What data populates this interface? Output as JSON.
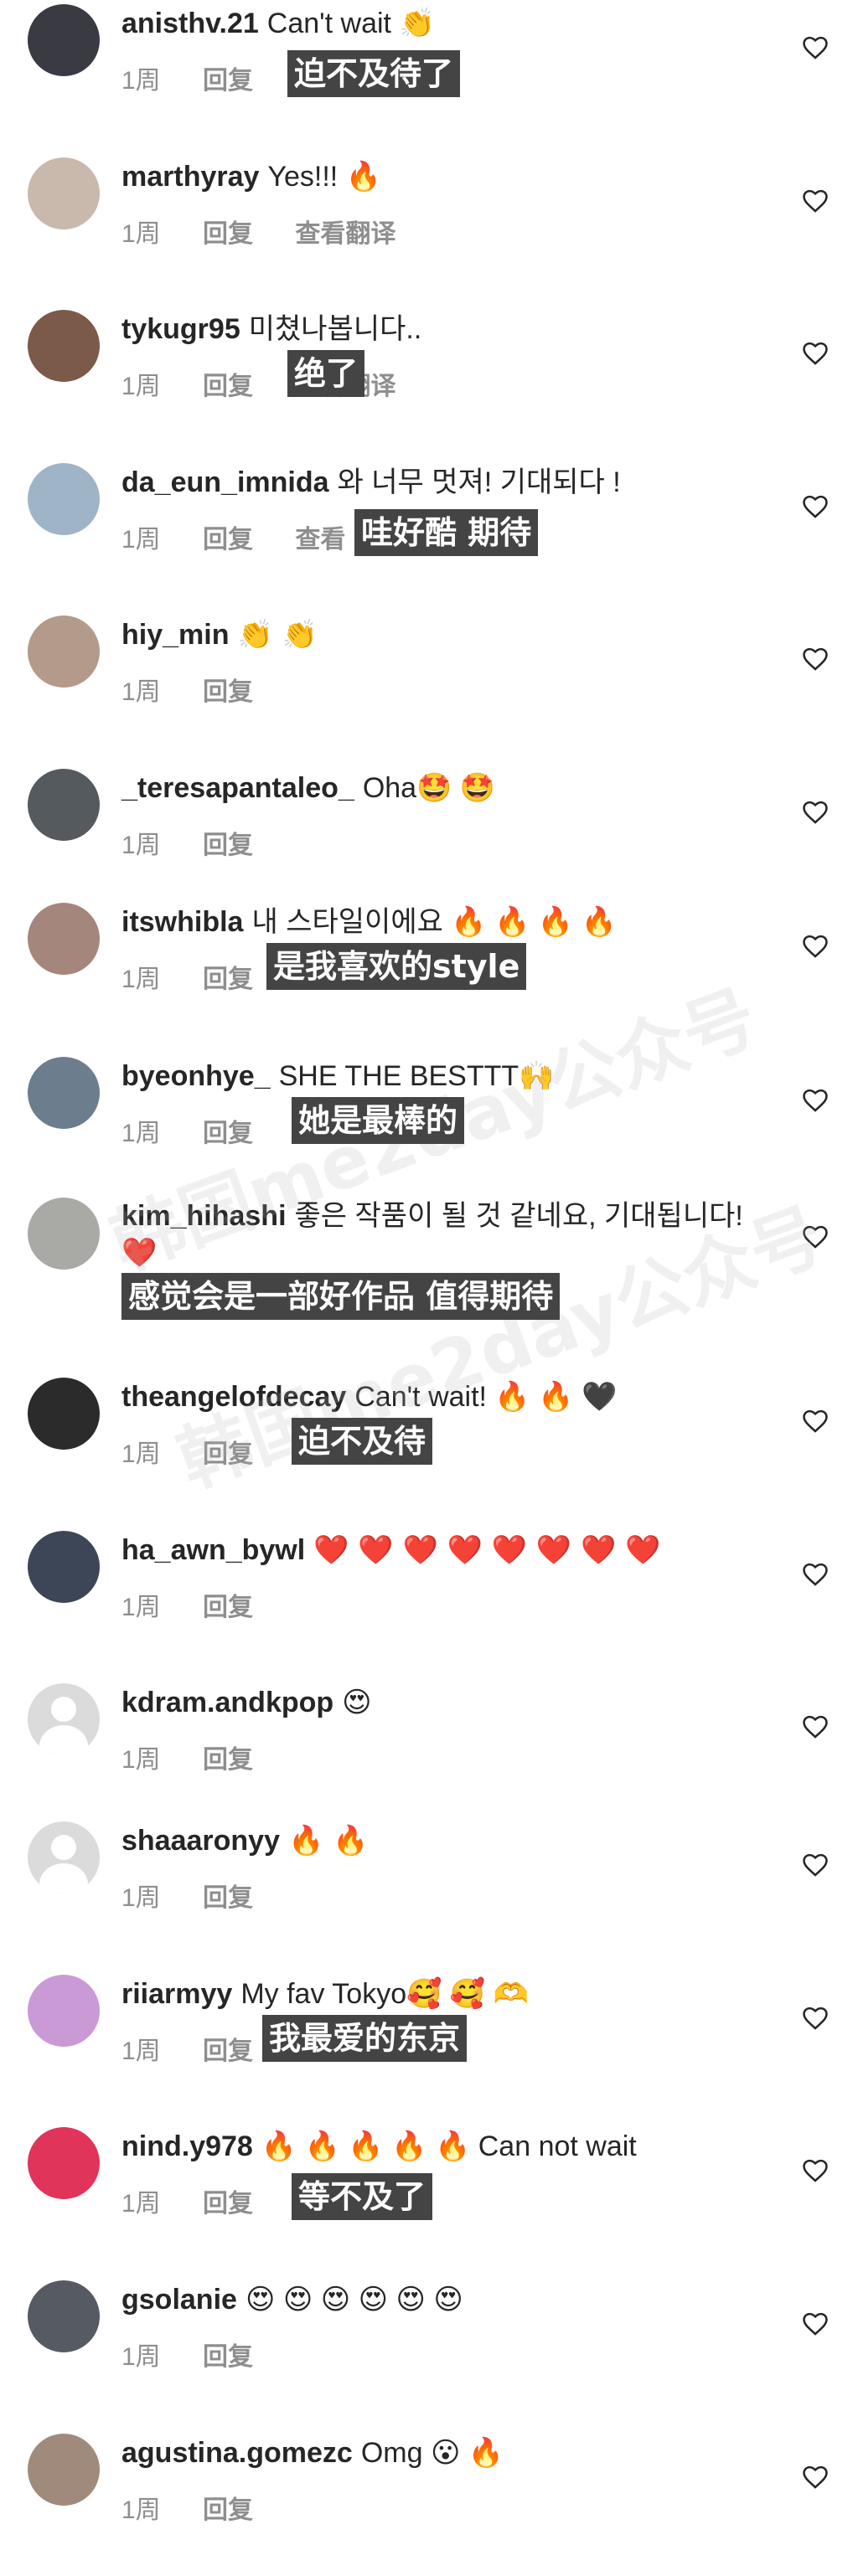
{
  "comments": [
    {
      "user": "anisthv.21",
      "text": "Can't wait 👏",
      "time": "1周",
      "reply": "回复",
      "translate": "",
      "trans": "迫不及待了",
      "avatar_color": "#3a3a42"
    },
    {
      "user": "marthyray",
      "text": "Yes!!! 🔥",
      "time": "1周",
      "reply": "回复",
      "translate": "查看翻译",
      "trans": "",
      "avatar_color": "#c9b9ad"
    },
    {
      "user": "tykugr95",
      "text": "미쳤나봅니다..",
      "time": "1周",
      "reply": "回复",
      "translate": "查看翻译",
      "trans": "绝了",
      "avatar_color": "#7b5a4a"
    },
    {
      "user": "da_eun_imnida",
      "text": "와 너무 멋져! 기대되다 !",
      "time": "1周",
      "reply": "回复",
      "translate": "查看",
      "trans": "哇好酷 期待",
      "avatar_color": "#9fb4c6"
    },
    {
      "user": "hiy_min",
      "text": "👏 👏",
      "time": "1周",
      "reply": "回复",
      "translate": "",
      "trans": "",
      "avatar_color": "#b39a8a"
    },
    {
      "user": "_teresapantaleo_",
      "text": "Oha🤩 🤩",
      "time": "1周",
      "reply": "回复",
      "translate": "",
      "trans": "",
      "avatar_color": "#555a5e"
    },
    {
      "user": "itswhibla",
      "text": "내 스타일이에요 🔥 🔥 🔥 🔥",
      "time": "1周",
      "reply": "回复",
      "translate": "",
      "trans": "是我喜欢的style",
      "avatar_color": "#a4867c"
    },
    {
      "user": "byeonhye_",
      "text": "SHE THE BESTTT🙌",
      "time": "1周",
      "reply": "回复",
      "translate": "",
      "trans": "她是最棒的",
      "avatar_color": "#6c7d8e"
    },
    {
      "user": "kim_hihashi",
      "text": "좋은 작품이 될 것 같네요, 기대됩니다!❤️",
      "time": "",
      "reply": "",
      "translate": "",
      "trans": "感觉会是一部好作品 值得期待",
      "avatar_color": "#a9aaa6"
    },
    {
      "user": "theangelofdecay",
      "text": "Can't wait! 🔥 🔥 🖤",
      "time": "1周",
      "reply": "回复",
      "translate": "",
      "trans": "迫不及待",
      "avatar_color": "#2b2b2b"
    },
    {
      "user": "ha_awn_bywl",
      "text": "❤️ ❤️ ❤️ ❤️ ❤️ ❤️ ❤️ ❤️",
      "time": "1周",
      "reply": "回复",
      "translate": "",
      "trans": "",
      "avatar_color": "#3d4656"
    },
    {
      "user": "kdram.andkpop",
      "text": "😍",
      "time": "1周",
      "reply": "回复",
      "translate": "",
      "trans": "",
      "avatar_color": ""
    },
    {
      "user": "shaaaronyy",
      "text": "🔥 🔥",
      "time": "1周",
      "reply": "回复",
      "translate": "",
      "trans": "",
      "avatar_color": ""
    },
    {
      "user": "riiarmyy",
      "text": "My fav Tokyo🥰 🥰 🫶",
      "time": "1周",
      "reply": "回复",
      "translate": "",
      "trans": "我最爱的东京",
      "avatar_color": "#c99ad6"
    },
    {
      "user": "nind.y978",
      "text": "🔥 🔥 🔥 🔥 🔥 Can not wait",
      "time": "1周",
      "reply": "回复",
      "translate": "",
      "trans": "等不及了",
      "avatar_color": "#e0345a"
    },
    {
      "user": "gsolanie",
      "text": "😍 😍 😍 😍 😍 😍",
      "time": "1周",
      "reply": "回复",
      "translate": "",
      "trans": "",
      "avatar_color": "#565a62"
    },
    {
      "user": "agustina.gomezc",
      "text": "Omg 😮 🔥",
      "time": "1周",
      "reply": "回复",
      "translate": "",
      "trans": "",
      "avatar_color": "#a08a7c"
    }
  ],
  "watermark": {
    "text": "韩国me2day公众号"
  },
  "colors": {
    "trans_bg": "#444444",
    "meta": "#8e8e8e",
    "username": "#262626"
  }
}
